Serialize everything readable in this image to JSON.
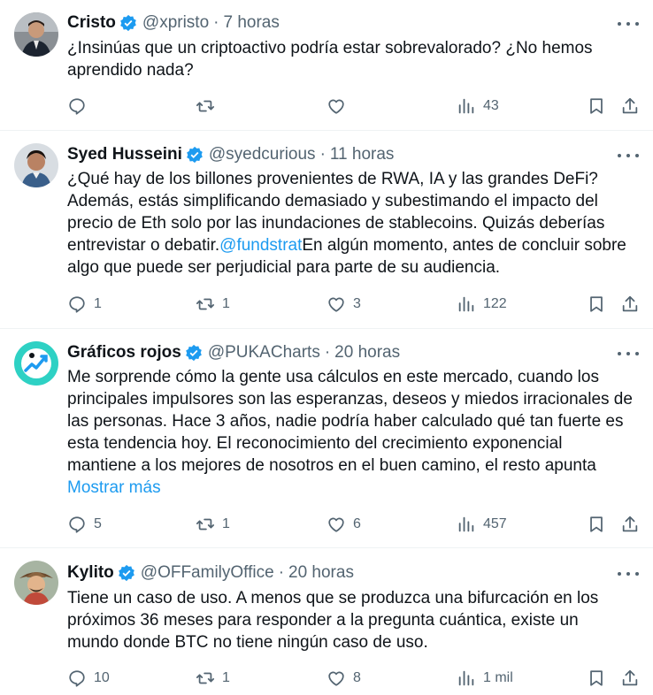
{
  "tweets": [
    {
      "name": "Cristo",
      "handle": "@xpristo",
      "time": "7 horas",
      "text": "¿Insinúas que un criptoactivo podría estar sobrevalorado? ¿No hemos\naprendido nada?",
      "mention": "",
      "text_after": "",
      "show_more": "",
      "replies": "",
      "retweets": "",
      "likes": "",
      "views": "43",
      "avatar": "man-in-suit-avatar"
    },
    {
      "name": "Syed Husseini",
      "handle": "@syedcurious",
      "time": "11 horas",
      "text": "¿Qué hay de los billones provenientes de RWA, IA y las grandes DeFi?\nAdemás, estás simplificando demasiado y subestimando el impacto del\nprecio de Eth solo por las inundaciones de stablecoins. Quizás deberías\nentrevistar o debatir.",
      "mention": "@fundstrat",
      "text_after": "En algún momento, antes de concluir sobre\nalgo que puede ser perjudicial para parte de su audiencia.",
      "show_more": "",
      "replies": "1",
      "retweets": "1",
      "likes": "3",
      "views": "122",
      "avatar": "man-portrait-avatar"
    },
    {
      "name": "Gráficos rojos",
      "handle": "@PUKACharts",
      "time": "20 horas",
      "text": "Me sorprende cómo la gente usa cálculos en este mercado, cuando los\nprincipales impulsores son las esperanzas, deseos y miedos irracionales de\nlas personas. Hace 3 años, nadie podría haber calculado qué tan fuerte es\nesta tendencia hoy. El reconocimiento del crecimiento exponencial\nmantiene a los mejores de nosotros en el buen camino, el resto apunta",
      "mention": "",
      "text_after": "",
      "show_more": "Mostrar más",
      "replies": "5",
      "retweets": "1",
      "likes": "6",
      "views": "457",
      "avatar": "chart-logo-avatar"
    },
    {
      "name": "Kylito",
      "handle": "@OFFamilyOffice",
      "time": "20 horas",
      "text": "Tiene un caso de uso. A menos que se produzca una bifurcación en los\npróximos 36 meses para responder a la pregunta cuántica, existe un\nmundo donde BTC no tiene ningún caso de uso.",
      "mention": "",
      "text_after": "",
      "show_more": "",
      "replies": "10",
      "retweets": "1",
      "likes": "8",
      "views": "1 mil",
      "avatar": "cartoon-hat-avatar"
    }
  ],
  "colors": {
    "accent": "#1d9bf0",
    "muted": "#536471",
    "text": "#0f1419",
    "border": "#eff3f4"
  }
}
